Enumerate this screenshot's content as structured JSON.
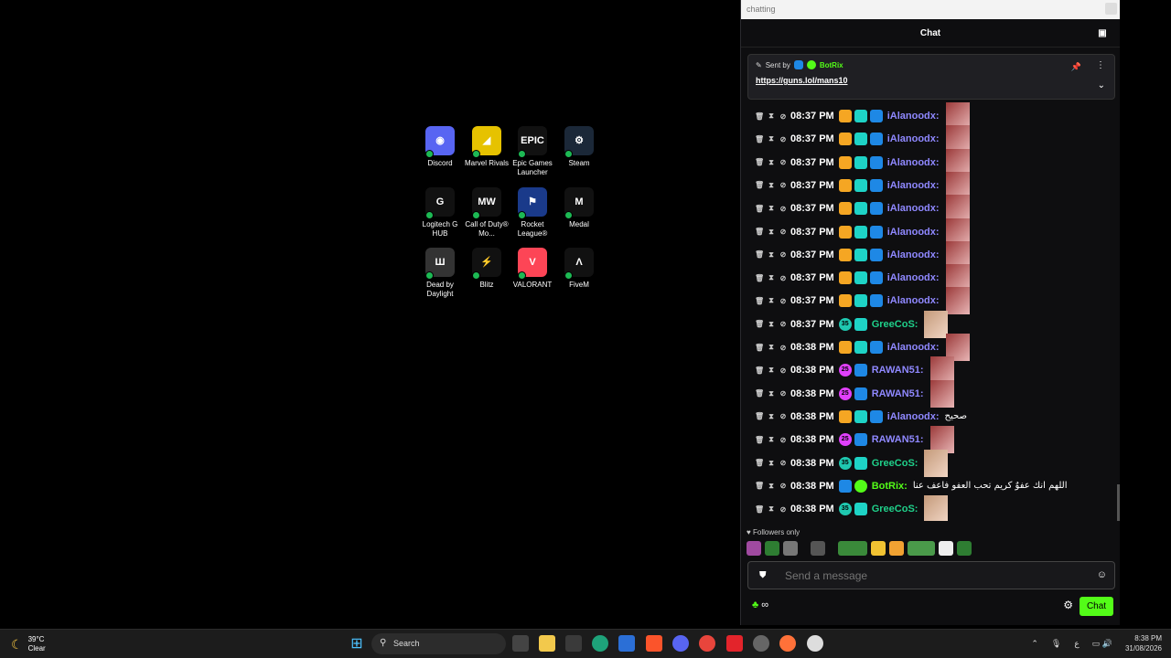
{
  "desktop": {
    "icons": [
      {
        "label": "Discord",
        "color": "#5865f2",
        "glyph": "◉"
      },
      {
        "label": "Marvel Rivals",
        "color": "#e6c200",
        "glyph": "◢"
      },
      {
        "label": "Epic Games Launcher",
        "color": "#111111",
        "glyph": "EPIC"
      },
      {
        "label": "Steam",
        "color": "#1b2838",
        "glyph": "⚙"
      },
      {
        "label": "Logitech G HUB",
        "color": "#111111",
        "glyph": "G"
      },
      {
        "label": "Call of Duty® Mo...",
        "color": "#111111",
        "glyph": "MW"
      },
      {
        "label": "Rocket League®",
        "color": "#1a3a8a",
        "glyph": "⚑"
      },
      {
        "label": "Medal",
        "color": "#111111",
        "glyph": "M"
      },
      {
        "label": "Dead by Daylight",
        "color": "#333333",
        "glyph": "Ш"
      },
      {
        "label": "Blitz",
        "color": "#111111",
        "glyph": "⚡"
      },
      {
        "label": "VALORANT",
        "color": "#fd4556",
        "glyph": "V"
      },
      {
        "label": "FiveM",
        "color": "#111111",
        "glyph": "Λ"
      }
    ]
  },
  "chat": {
    "window_title": "chatting",
    "header": "Chat",
    "pinned": {
      "sent_by": "Sent by",
      "bot_name": "BotRix",
      "link": "https://guns.lol/mans10"
    },
    "messages": [
      {
        "time": "08:37 PM",
        "user": "iAlanoodx:",
        "color": "#8f88ff",
        "badges": [
          "crown",
          "og",
          "vip"
        ],
        "emote": "red",
        "text": ""
      },
      {
        "time": "08:37 PM",
        "user": "iAlanoodx:",
        "color": "#8f88ff",
        "badges": [
          "crown",
          "og",
          "vip"
        ],
        "emote": "red",
        "text": ""
      },
      {
        "time": "08:37 PM",
        "user": "iAlanoodx:",
        "color": "#8f88ff",
        "badges": [
          "crown",
          "og",
          "vip"
        ],
        "emote": "red",
        "text": ""
      },
      {
        "time": "08:37 PM",
        "user": "iAlanoodx:",
        "color": "#8f88ff",
        "badges": [
          "crown",
          "og",
          "vip"
        ],
        "emote": "red",
        "text": ""
      },
      {
        "time": "08:37 PM",
        "user": "iAlanoodx:",
        "color": "#8f88ff",
        "badges": [
          "crown",
          "og",
          "vip"
        ],
        "emote": "red",
        "text": ""
      },
      {
        "time": "08:37 PM",
        "user": "iAlanoodx:",
        "color": "#8f88ff",
        "badges": [
          "crown",
          "og",
          "vip"
        ],
        "emote": "red",
        "text": ""
      },
      {
        "time": "08:37 PM",
        "user": "iAlanoodx:",
        "color": "#8f88ff",
        "badges": [
          "crown",
          "og",
          "vip"
        ],
        "emote": "red",
        "text": ""
      },
      {
        "time": "08:37 PM",
        "user": "iAlanoodx:",
        "color": "#8f88ff",
        "badges": [
          "crown",
          "og",
          "vip"
        ],
        "emote": "red",
        "text": ""
      },
      {
        "time": "08:37 PM",
        "user": "iAlanoodx:",
        "color": "#8f88ff",
        "badges": [
          "crown",
          "og",
          "vip"
        ],
        "emote": "red",
        "text": ""
      },
      {
        "time": "08:37 PM",
        "user": "GreeCoS:",
        "color": "#1fd08a",
        "badges": [
          "sub35",
          "og"
        ],
        "emote": "tan",
        "text": ""
      },
      {
        "time": "08:38 PM",
        "user": "iAlanoodx:",
        "color": "#8f88ff",
        "badges": [
          "crown",
          "og",
          "vip"
        ],
        "emote": "red",
        "text": ""
      },
      {
        "time": "08:38 PM",
        "user": "RAWAN51:",
        "color": "#8f88ff",
        "badges": [
          "sub25",
          "vip"
        ],
        "emote": "red",
        "text": ""
      },
      {
        "time": "08:38 PM",
        "user": "RAWAN51:",
        "color": "#8f88ff",
        "badges": [
          "sub25",
          "vip"
        ],
        "emote": "red",
        "text": ""
      },
      {
        "time": "08:38 PM",
        "user": "iAlanoodx:",
        "color": "#8f88ff",
        "badges": [
          "crown",
          "og",
          "vip"
        ],
        "emote": "",
        "text": "صحيح"
      },
      {
        "time": "08:38 PM",
        "user": "RAWAN51:",
        "color": "#8f88ff",
        "badges": [
          "sub25",
          "vip"
        ],
        "emote": "red",
        "text": ""
      },
      {
        "time": "08:38 PM",
        "user": "GreeCoS:",
        "color": "#1fd08a",
        "badges": [
          "sub35",
          "og"
        ],
        "emote": "tan",
        "text": ""
      },
      {
        "time": "08:38 PM",
        "user": "BotRix:",
        "color": "#53fc18",
        "badges": [
          "vip",
          "verif"
        ],
        "emote": "",
        "text": "اللهم انك عفوٌ كريم تحب العفو فاعف عنا"
      },
      {
        "time": "08:38 PM",
        "user": "GreeCoS:",
        "color": "#1fd08a",
        "badges": [
          "sub35",
          "og"
        ],
        "emote": "tan",
        "text": ""
      }
    ],
    "followers_only": "Followers only",
    "input_placeholder": "Send a message",
    "points": "∞",
    "chat_button": "Chat"
  },
  "taskbar": {
    "weather_temp": "39°C",
    "weather_desc": "Clear",
    "search_label": "Search",
    "time": "8:38 PM",
    "date": "31/08/2026",
    "lang": "ع"
  }
}
